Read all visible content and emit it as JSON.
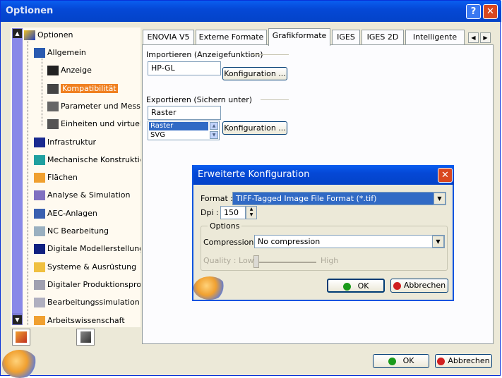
{
  "window": {
    "title": "Optionen",
    "help_label": "?",
    "close_label": "✕"
  },
  "tree": {
    "root": "Optionen",
    "items": [
      {
        "label": "Allgemein",
        "icon": "gear-icon"
      },
      {
        "label": "Anzeige",
        "icon": "display-icon"
      },
      {
        "label": "Kompatibilität",
        "icon": "compat-icon",
        "selected": true
      },
      {
        "label": "Parameter und Messung",
        "icon": "parameter-icon"
      },
      {
        "label": "Einheiten und virtuelle F",
        "icon": "units-icon"
      },
      {
        "label": "Infrastruktur",
        "icon": "infra-icon"
      },
      {
        "label": "Mechanische Konstruktion",
        "icon": "mech-icon"
      },
      {
        "label": "Flächen",
        "icon": "surface-icon"
      },
      {
        "label": "Analyse & Simulation",
        "icon": "analysis-icon"
      },
      {
        "label": "AEC-Anlagen",
        "icon": "aec-icon"
      },
      {
        "label": "NC Bearbeitung",
        "icon": "nc-icon"
      },
      {
        "label": "Digitale Modellerstellung",
        "icon": "digital-model-icon"
      },
      {
        "label": "Systeme & Ausrüstung",
        "icon": "systems-icon"
      },
      {
        "label": "Digitaler Produktionsprozes",
        "icon": "production-icon"
      },
      {
        "label": "Bearbeitungssimulation",
        "icon": "machining-sim-icon"
      },
      {
        "label": "Arbeitswissenschaft",
        "icon": "ergonomics-icon"
      }
    ]
  },
  "tabs": [
    {
      "label": "ENOVIA V5"
    },
    {
      "label": "Externe Formate"
    },
    {
      "label": "Grafikformate",
      "active": true
    },
    {
      "label": "IGES"
    },
    {
      "label": "IGES 2D"
    },
    {
      "label": "Intelligente Stüc"
    }
  ],
  "import": {
    "group_label": "Importieren (Anzeigefunktion)",
    "value": "HP-GL",
    "config_label": "Konfiguration ..."
  },
  "export": {
    "group_label": "Exportieren (Sichern unter)",
    "value": "Raster",
    "list_options": [
      "Raster",
      "SVG"
    ],
    "config_label": "Konfiguration ..."
  },
  "dialog": {
    "title": "Erweiterte Konfiguration",
    "format_label": "Format :",
    "format_value": "TIFF-Tagged Image File Format (*.tif)",
    "dpi_label": "Dpi :",
    "dpi_value": "150",
    "options_label": "Options",
    "compression_label": "Compression :",
    "compression_value": "No compression",
    "quality_label": "Quality : Low",
    "quality_high": "High",
    "ok_label": "OK",
    "cancel_label": "Abbrechen"
  },
  "footer": {
    "ok_label": "OK",
    "cancel_label": "Abbrechen"
  },
  "colors": {
    "selection": "#f08020",
    "titlebar": "#0548d6",
    "ok_dot": "#1a9a1a",
    "cancel_dot": "#d02020"
  }
}
